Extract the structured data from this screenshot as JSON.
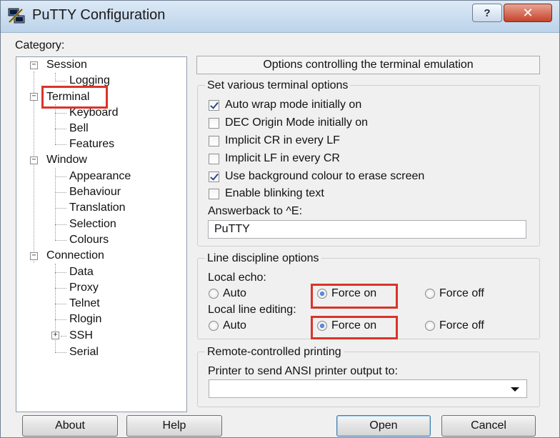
{
  "window": {
    "title": "PuTTY Configuration",
    "help_label": "?",
    "close_label": "✕"
  },
  "category": {
    "label": "Category:",
    "tree": [
      {
        "id": "session",
        "label": "Session",
        "level": 0,
        "expander": "−"
      },
      {
        "id": "logging",
        "label": "Logging",
        "level": 1
      },
      {
        "id": "terminal",
        "label": "Terminal",
        "level": 0,
        "expander": "−",
        "highlighted": true
      },
      {
        "id": "keyboard",
        "label": "Keyboard",
        "level": 1
      },
      {
        "id": "bell",
        "label": "Bell",
        "level": 1
      },
      {
        "id": "features",
        "label": "Features",
        "level": 1
      },
      {
        "id": "window",
        "label": "Window",
        "level": 0,
        "expander": "−"
      },
      {
        "id": "appearance",
        "label": "Appearance",
        "level": 1
      },
      {
        "id": "behaviour",
        "label": "Behaviour",
        "level": 1
      },
      {
        "id": "translation",
        "label": "Translation",
        "level": 1
      },
      {
        "id": "selection",
        "label": "Selection",
        "level": 1
      },
      {
        "id": "colours",
        "label": "Colours",
        "level": 1
      },
      {
        "id": "connection",
        "label": "Connection",
        "level": 0,
        "expander": "−"
      },
      {
        "id": "data",
        "label": "Data",
        "level": 1
      },
      {
        "id": "proxy",
        "label": "Proxy",
        "level": 1
      },
      {
        "id": "telnet",
        "label": "Telnet",
        "level": 1
      },
      {
        "id": "rlogin",
        "label": "Rlogin",
        "level": 1
      },
      {
        "id": "ssh",
        "label": "SSH",
        "level": 1,
        "expander": "+"
      },
      {
        "id": "serial",
        "label": "Serial",
        "level": 1
      }
    ]
  },
  "panel": {
    "title": "Options controlling the terminal emulation",
    "terminal_options": {
      "title": "Set various terminal options",
      "checkboxes": [
        {
          "label": "Auto wrap mode initially on",
          "checked": true
        },
        {
          "label": "DEC Origin Mode initially on",
          "checked": false
        },
        {
          "label": "Implicit CR in every LF",
          "checked": false
        },
        {
          "label": "Implicit LF in every CR",
          "checked": false
        },
        {
          "label": "Use background colour to erase screen",
          "checked": true
        },
        {
          "label": "Enable blinking text",
          "checked": false
        }
      ],
      "answerback_label": "Answerback to ^E:",
      "answerback_value": "PuTTY"
    },
    "line_discipline": {
      "title": "Line discipline options",
      "local_echo_label": "Local echo:",
      "local_echo_options": [
        "Auto",
        "Force on",
        "Force off"
      ],
      "local_echo_selected": "Force on",
      "local_editing_label": "Local line editing:",
      "local_editing_options": [
        "Auto",
        "Force on",
        "Force off"
      ],
      "local_editing_selected": "Force on"
    },
    "remote_printing": {
      "title": "Remote-controlled printing",
      "printer_label": "Printer to send ANSI printer output to:",
      "printer_value": ""
    }
  },
  "buttons": {
    "about": "About",
    "help": "Help",
    "open": "Open",
    "cancel": "Cancel"
  },
  "colors": {
    "highlight": "#d9342b",
    "close_button": "#c7422a",
    "titlebar": "#cddff1"
  }
}
